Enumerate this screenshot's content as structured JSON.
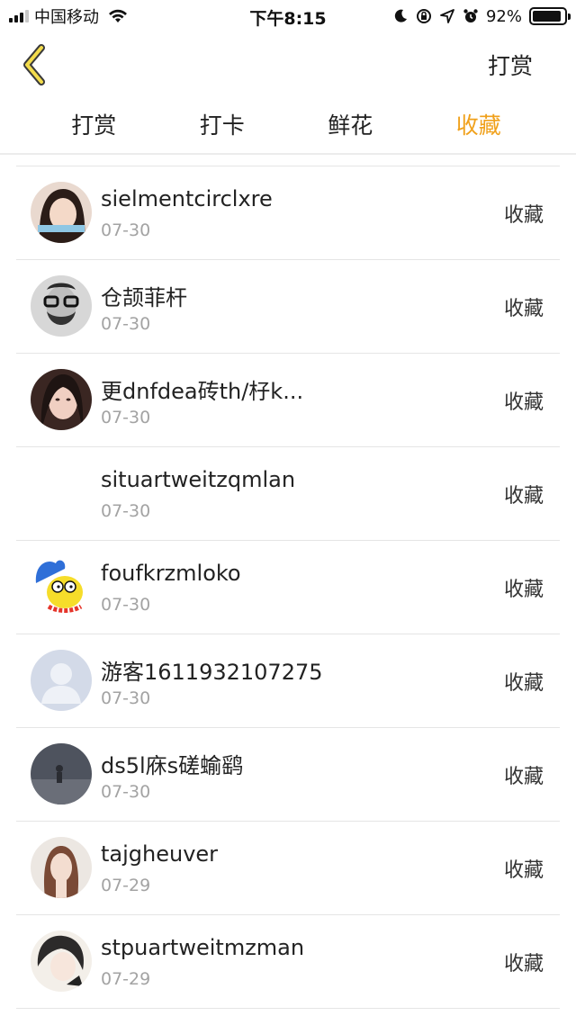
{
  "status_bar": {
    "carrier": "中国移动",
    "time": "下午8:15",
    "battery": "92%",
    "battery_level": 0.92,
    "icons": [
      "signal-icon",
      "wifi-icon",
      "moon-icon",
      "rotation-lock-icon",
      "location-arrow-icon",
      "alarm-icon",
      "battery-icon"
    ]
  },
  "nav": {
    "back_icon": "chevron-left-icon",
    "action_label": "打赏"
  },
  "tabs": [
    {
      "label": "打赏",
      "active": false
    },
    {
      "label": "打卡",
      "active": false
    },
    {
      "label": "鲜花",
      "active": false
    },
    {
      "label": "收藏",
      "active": true
    }
  ],
  "accent_color": "#f0a11c",
  "list": [
    {
      "name": "sielmentcirclxre",
      "date": "07-30",
      "action": "收藏",
      "avatar": "girl-photo-avatar"
    },
    {
      "name": "仓颉菲杆",
      "date": "07-30",
      "action": "收藏",
      "avatar": "bearded-man-glasses-avatar"
    },
    {
      "name": "更dnfdea砖th/杍k...",
      "date": "07-30",
      "action": "收藏",
      "avatar": "girl-photo-avatar"
    },
    {
      "name": "situartweitzqmlan",
      "date": "07-30",
      "action": "收藏",
      "avatar": "blank-avatar"
    },
    {
      "name": "foufkrzmloko",
      "date": "07-30",
      "action": "收藏",
      "avatar": "cartoon-avatar"
    },
    {
      "name": "游客1611932107275",
      "date": "07-30",
      "action": "收藏",
      "avatar": "default-user-avatar"
    },
    {
      "name": "ds5l庥s磋蝓鹞",
      "date": "07-30",
      "action": "收藏",
      "avatar": "dark-scene-avatar"
    },
    {
      "name": "tajgheuver",
      "date": "07-29",
      "action": "收藏",
      "avatar": "girl-photo-avatar"
    },
    {
      "name": "stpuartweitmzman",
      "date": "07-29",
      "action": "收藏",
      "avatar": "anime-avatar"
    }
  ]
}
